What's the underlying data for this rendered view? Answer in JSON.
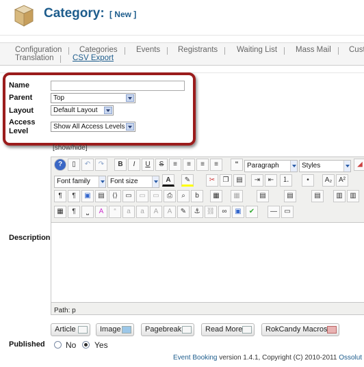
{
  "header": {
    "title": "Category:",
    "subtitle": "[ New ]"
  },
  "tabs": [
    {
      "label": "Configuration"
    },
    {
      "label": "Categories"
    },
    {
      "label": "Events"
    },
    {
      "label": "Registrants"
    },
    {
      "label": "Waiting List"
    },
    {
      "label": "Mass Mail"
    },
    {
      "label": "Cust"
    },
    {
      "label": "Translation"
    },
    {
      "label": "CSV Export"
    }
  ],
  "form": {
    "name_label": "Name",
    "name_value": "",
    "parent_label": "Parent",
    "parent_value": "Top",
    "layout_label": "Layout",
    "layout_value": "Default Layout",
    "access_label": "Access",
    "access_label2": "Level",
    "access_value": "Show All Access Levels",
    "description_label": "Description",
    "show_hide": "[show/hide]",
    "published_label": "Published",
    "published_no": "No",
    "published_yes": "Yes"
  },
  "editor": {
    "format_select": "Paragraph",
    "styles_select": "Styles",
    "font_family": "Font family",
    "font_size": "Font size",
    "path_label": "Path:",
    "path_value": "p"
  },
  "editor_buttons": [
    {
      "label": "Article"
    },
    {
      "label": "Image"
    },
    {
      "label": "Pagebreak"
    },
    {
      "label": "Read More"
    },
    {
      "label": "RokCandy Macros"
    }
  ],
  "footer": {
    "brand": "Event Booking",
    "text": " version 1.4.1, Copyright (C) 2010-2011 ",
    "vendor": "Ossolut"
  },
  "colors": {
    "accent": "#1d5c8c",
    "highlight": "#9b1c1c"
  }
}
